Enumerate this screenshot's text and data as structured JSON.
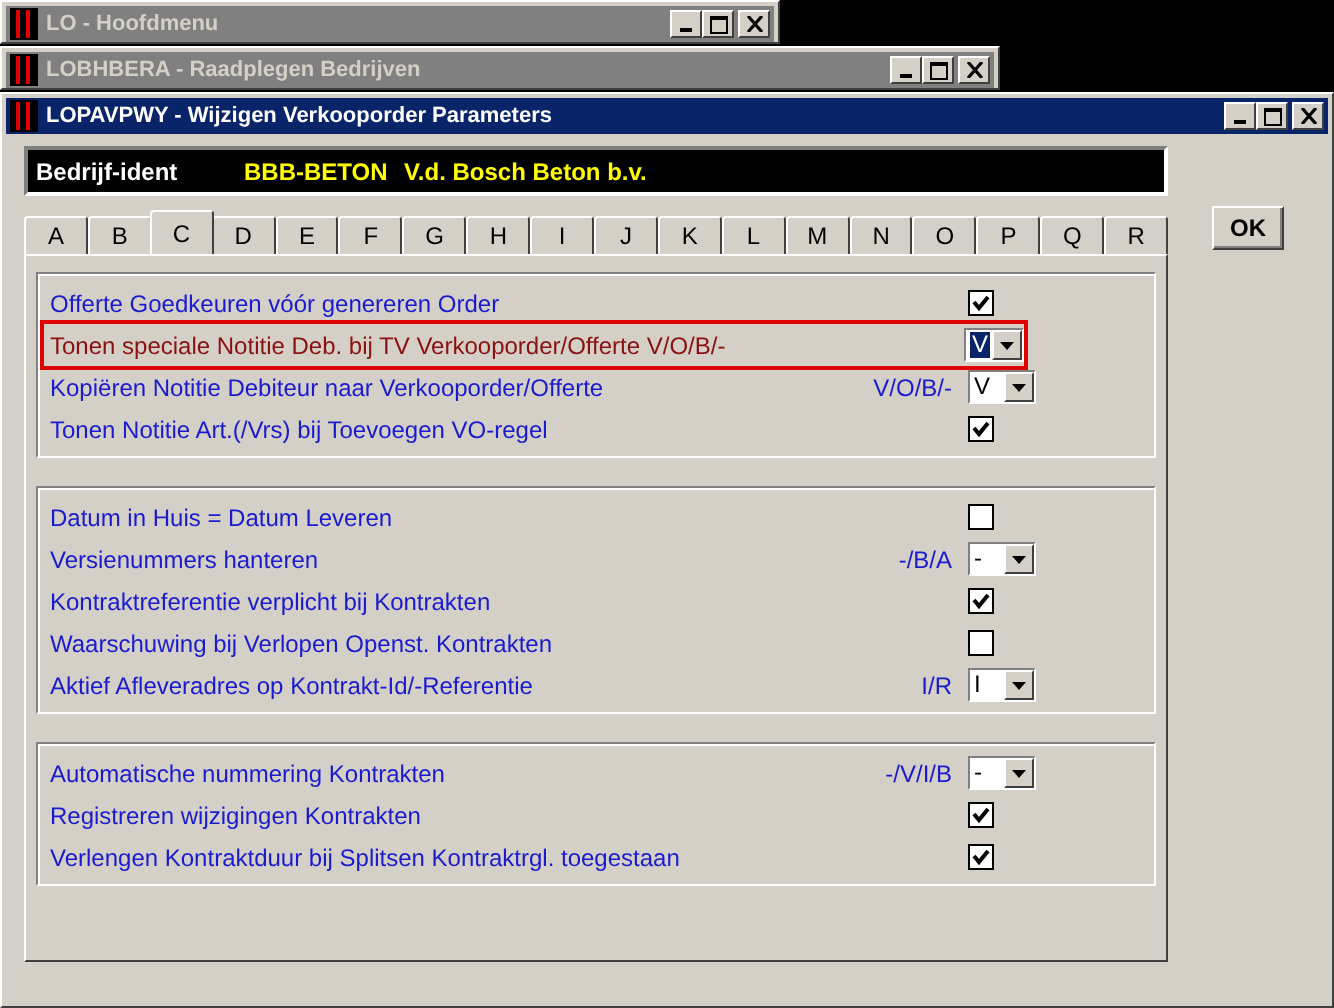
{
  "windows": [
    {
      "title": "LO - Hoofdmenu",
      "active": false
    },
    {
      "title": "LOBHBERA - Raadplegen Bedrijven",
      "active": false
    },
    {
      "title": "LOPAVPWY - Wijzigen Verkooporder Parameters",
      "active": true
    }
  ],
  "company": {
    "label": "Bedrijf-ident",
    "code": "BBB-BETON",
    "name": "V.d. Bosch Beton b.v."
  },
  "tabs": [
    {
      "label": "A",
      "selected": false
    },
    {
      "label": "B",
      "selected": false
    },
    {
      "label": "C",
      "selected": true
    },
    {
      "label": "D",
      "selected": false
    },
    {
      "label": "E",
      "selected": false
    },
    {
      "label": "F",
      "selected": false
    },
    {
      "label": "G",
      "selected": false
    },
    {
      "label": "H",
      "selected": false
    },
    {
      "label": "I",
      "selected": false
    },
    {
      "label": "J",
      "selected": false
    },
    {
      "label": "K",
      "selected": false
    },
    {
      "label": "L",
      "selected": false
    },
    {
      "label": "M",
      "selected": false
    },
    {
      "label": "N",
      "selected": false
    },
    {
      "label": "O",
      "selected": false
    },
    {
      "label": "P",
      "selected": false
    },
    {
      "label": "Q",
      "selected": false
    },
    {
      "label": "R",
      "selected": false
    }
  ],
  "groups": [
    {
      "rows": [
        {
          "kind": "checkbox",
          "label": "Offerte Goedkeuren vóór genereren Order",
          "checked": true,
          "highlighted": false
        },
        {
          "kind": "select",
          "label": "Tonen speciale Notitie Deb. bij TV Verkooporder/Offerte V/O/B/-",
          "value": "V",
          "focused": true,
          "highlighted": true
        },
        {
          "kind": "select",
          "label": "Kopiëren Notitie Debiteur naar Verkooporder/Offerte",
          "hint": "V/O/B/-",
          "value": "V",
          "focused": false,
          "highlighted": false
        },
        {
          "kind": "checkbox",
          "label": "Tonen Notitie Art.(/Vrs) bij Toevoegen VO-regel",
          "checked": true,
          "highlighted": false
        }
      ]
    },
    {
      "rows": [
        {
          "kind": "checkbox",
          "label": "Datum in Huis = Datum Leveren",
          "checked": false,
          "highlighted": false
        },
        {
          "kind": "select",
          "label": "Versienummers hanteren",
          "hint": "-/B/A",
          "value": "-",
          "focused": false,
          "highlighted": false
        },
        {
          "kind": "checkbox",
          "label": "Kontraktreferentie verplicht bij Kontrakten",
          "checked": true,
          "highlighted": false
        },
        {
          "kind": "checkbox",
          "label": "Waarschuwing bij Verlopen Openst. Kontrakten",
          "checked": false,
          "highlighted": false
        },
        {
          "kind": "select",
          "label": "Aktief Afleveradres op Kontrakt-Id/-Referentie",
          "hint": "I/R",
          "value": "I",
          "focused": false,
          "highlighted": false
        }
      ]
    },
    {
      "rows": [
        {
          "kind": "select",
          "label": "Automatische nummering Kontrakten",
          "hint": "-/V/I/B",
          "value": "-",
          "focused": false,
          "highlighted": false
        },
        {
          "kind": "checkbox",
          "label": "Registreren wijzigingen Kontrakten",
          "checked": true,
          "highlighted": false
        },
        {
          "kind": "checkbox",
          "label": "Verlengen Kontraktduur bij Splitsen Kontraktrgl. toegestaan",
          "checked": true,
          "highlighted": false
        }
      ]
    }
  ],
  "ok_button": "OK"
}
